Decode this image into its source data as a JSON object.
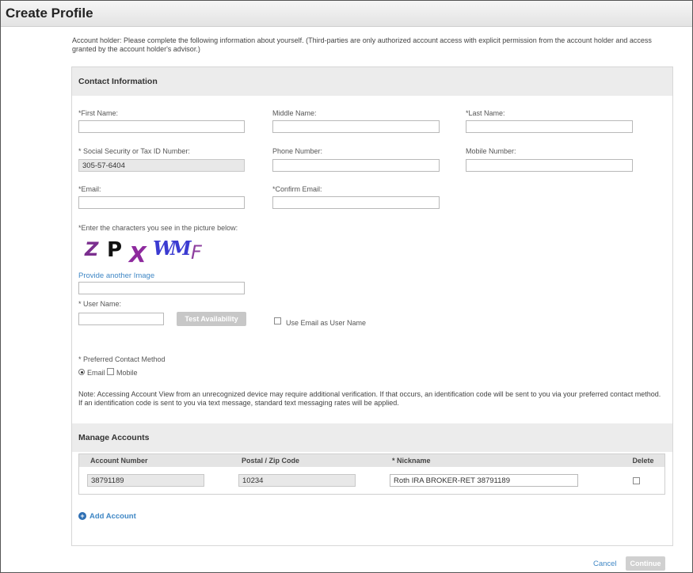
{
  "page_title": "Create Profile",
  "intro_text": "Account holder: Please complete the following information about yourself. (Third-parties are only authorized account access with explicit permission from the account holder and access granted by the account holder's advisor.)",
  "contact": {
    "heading": "Contact Information",
    "first_name_label": "*First Name:",
    "first_name_value": "",
    "middle_name_label": "Middle Name:",
    "middle_name_value": "",
    "last_name_label": "*Last Name:",
    "last_name_value": "",
    "ssn_label": "* Social Security or Tax ID Number:",
    "ssn_value": "305-57-6404",
    "phone_label": "Phone Number:",
    "phone_value": "",
    "mobile_label": "Mobile Number:",
    "mobile_value": "",
    "email_label": "*Email:",
    "email_value": "",
    "confirm_email_label": "*Confirm Email:",
    "confirm_email_value": "",
    "captcha_label": "*Enter the characters you see in the picture below:",
    "captcha_chars": [
      "Z",
      "P",
      "X",
      "W",
      "M",
      "F"
    ],
    "captcha_colors": [
      "#7b2f8f",
      "#111111",
      "#8e2a9e",
      "#3b3bd1",
      "#3b3bd1",
      "#8e3f9f"
    ],
    "another_image_link": "Provide another Image",
    "captcha_value": "",
    "username_label": "* User Name:",
    "username_value": "",
    "test_availability_button": "Test Availability",
    "use_email_checkbox_label": "Use Email as User Name",
    "use_email_checked": false,
    "preferred_contact_label": "* Preferred Contact Method",
    "contact_method_options": [
      "Email",
      "Mobile"
    ],
    "contact_method_selected": "Email",
    "note_text": "Note: Accessing Account View from an unrecognized device may require additional verification. If that occurs, an identification code will be sent to you via your preferred contact method. If an identification code is sent to you via text message, standard text messaging rates will be applied."
  },
  "accounts": {
    "heading": "Manage Accounts",
    "columns": [
      "Account Number",
      "Postal / Zip Code",
      "* Nickname",
      "Delete"
    ],
    "rows": [
      {
        "account_number": "38791189",
        "postal_code": "10234",
        "nickname": "Roth IRA  BROKER-RET 38791189",
        "delete_checked": false
      }
    ],
    "add_account_link": "Add Account"
  },
  "footer": {
    "cancel_label": "Cancel",
    "continue_label": "Continue"
  },
  "colors": {
    "link": "#3f87c5",
    "section_bg": "#ececec",
    "disabled_button": "#c7c7c7"
  }
}
